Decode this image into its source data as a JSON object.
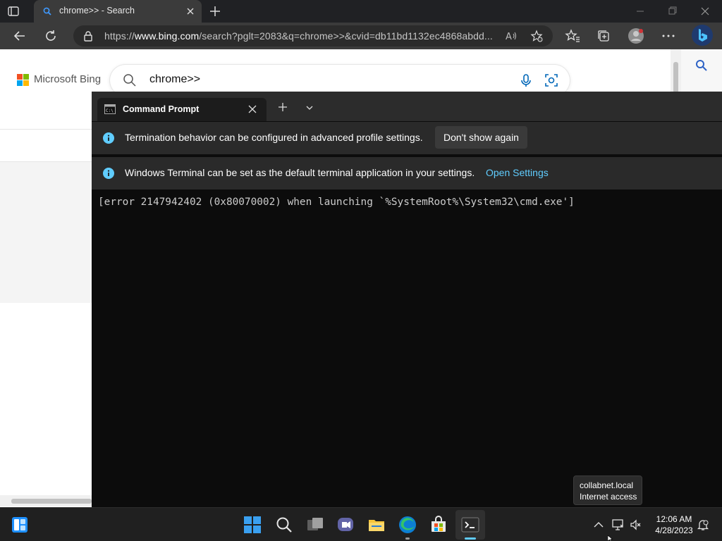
{
  "browser": {
    "tab": {
      "title": "chrome>> - Search"
    },
    "url": {
      "host": "www.bing.com",
      "prefix": "https://",
      "rest": "/search?pglt=2083&q=chrome>>&cvid=db11bd1132ec4868abdd..."
    },
    "icons": [
      "tab-actions-icon",
      "back-icon",
      "refresh-icon",
      "lock-icon",
      "read-aloud-icon",
      "add-favorite-icon",
      "favorites-icon",
      "collections-icon",
      "profile-icon",
      "more-icon",
      "bing-chat-icon",
      "search-icon"
    ]
  },
  "bing": {
    "brand": "Microsoft Bing",
    "query": "chrome>>"
  },
  "terminal": {
    "tab_title": "Command Prompt",
    "infobar1": {
      "message": "Termination behavior can be configured in advanced profile settings.",
      "button": "Don't show again"
    },
    "infobar2": {
      "message": "Windows Terminal can be set as the default terminal application in your settings.",
      "link": "Open Settings"
    },
    "output": "[error 2147942402 (0x80070002) when launching `%SystemRoot%\\System32\\cmd.exe']"
  },
  "tooltip": {
    "line1": "collabnet.local",
    "line2": "Internet access"
  },
  "taskbar": {
    "time": "12:06 AM",
    "date": "4/28/2023",
    "apps": [
      "widgets",
      "start",
      "search",
      "task-view",
      "teams-chat",
      "file-explorer",
      "edge",
      "microsoft-store",
      "terminal"
    ]
  },
  "colors": {
    "accent": "#60cdff",
    "terminal_bg": "#0c0c0c",
    "infobar_bg": "#2a2a2a",
    "chrome_bg": "#3b3b3b"
  }
}
